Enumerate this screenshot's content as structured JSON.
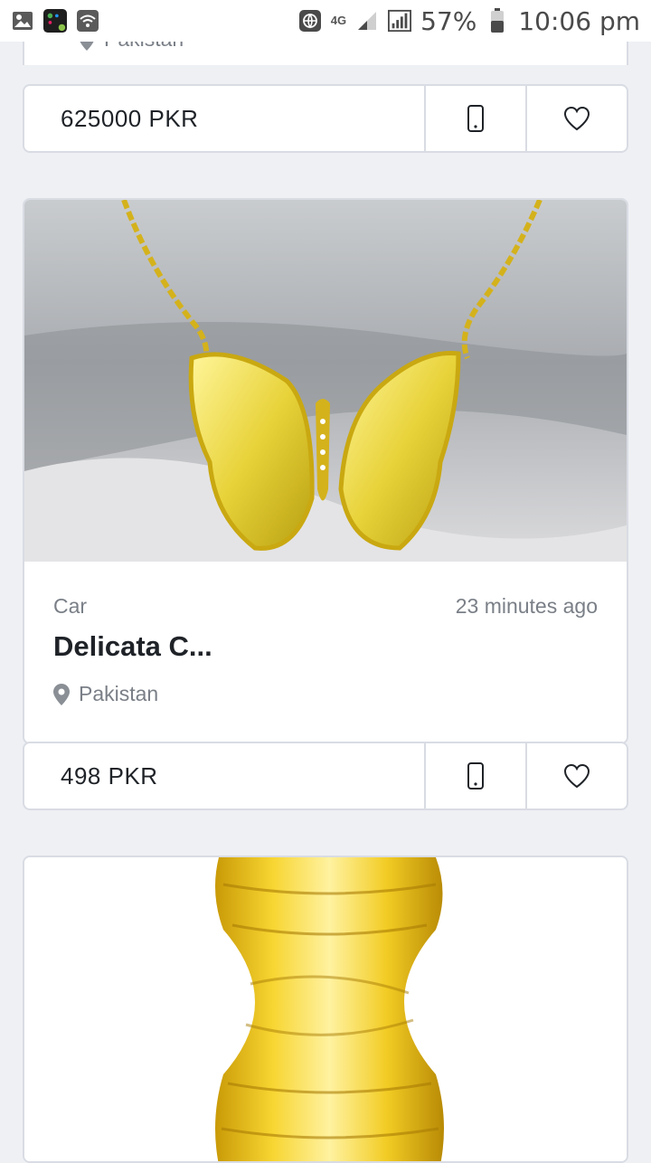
{
  "status_bar": {
    "battery": "57%",
    "time": "10:06 pm",
    "network": "4G"
  },
  "listings": [
    {
      "location": "Pakistan",
      "price": "625000 PKR",
      "icons": {
        "phone": "phone-icon",
        "favorite": "heart-icon"
      }
    },
    {
      "category": "Car",
      "time_ago": "23 minutes ago",
      "title": "Delicata C...",
      "location": "Pakistan",
      "price": "498 PKR",
      "image": "yellow-butterfly-necklace",
      "icons": {
        "location": "map-pin-icon",
        "phone": "phone-icon",
        "favorite": "heart-icon"
      }
    },
    {
      "image": "yellow-oil-bottle"
    }
  ],
  "colors": {
    "background": "#eef0f4",
    "card_border": "#d9dce3",
    "text_primary": "#1f2328",
    "text_secondary": "#7a7f87"
  }
}
